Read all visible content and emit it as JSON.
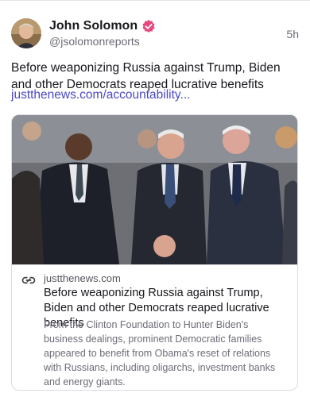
{
  "author": {
    "name": "John Solomon",
    "handle": "@jsolomonreports",
    "verified_color": "#e8467c"
  },
  "post": {
    "time": "5h",
    "text": "Before weaponizing Russia against Trump, Biden and other Democrats reaped lucrative benefits",
    "link_text": "justthenews.com/accountability...",
    "link_color": "#4b49c7"
  },
  "card": {
    "image_alt": "Photo of Obama, Biden and Bill Clinton talking",
    "domain": "justthenews.com",
    "title": "Before weaponizing Russia against Trump, Biden and other Democrats reaped lucrative benefits",
    "description": "From the Clinton Foundation to Hunter Biden's business dealings, prominent Democratic families appeared to benefit from Obama's reset of relations with Russians, including oligarchs, investment banks and energy giants."
  },
  "icons": {
    "verified": "verified-badge-icon",
    "link": "link-chain-icon"
  }
}
